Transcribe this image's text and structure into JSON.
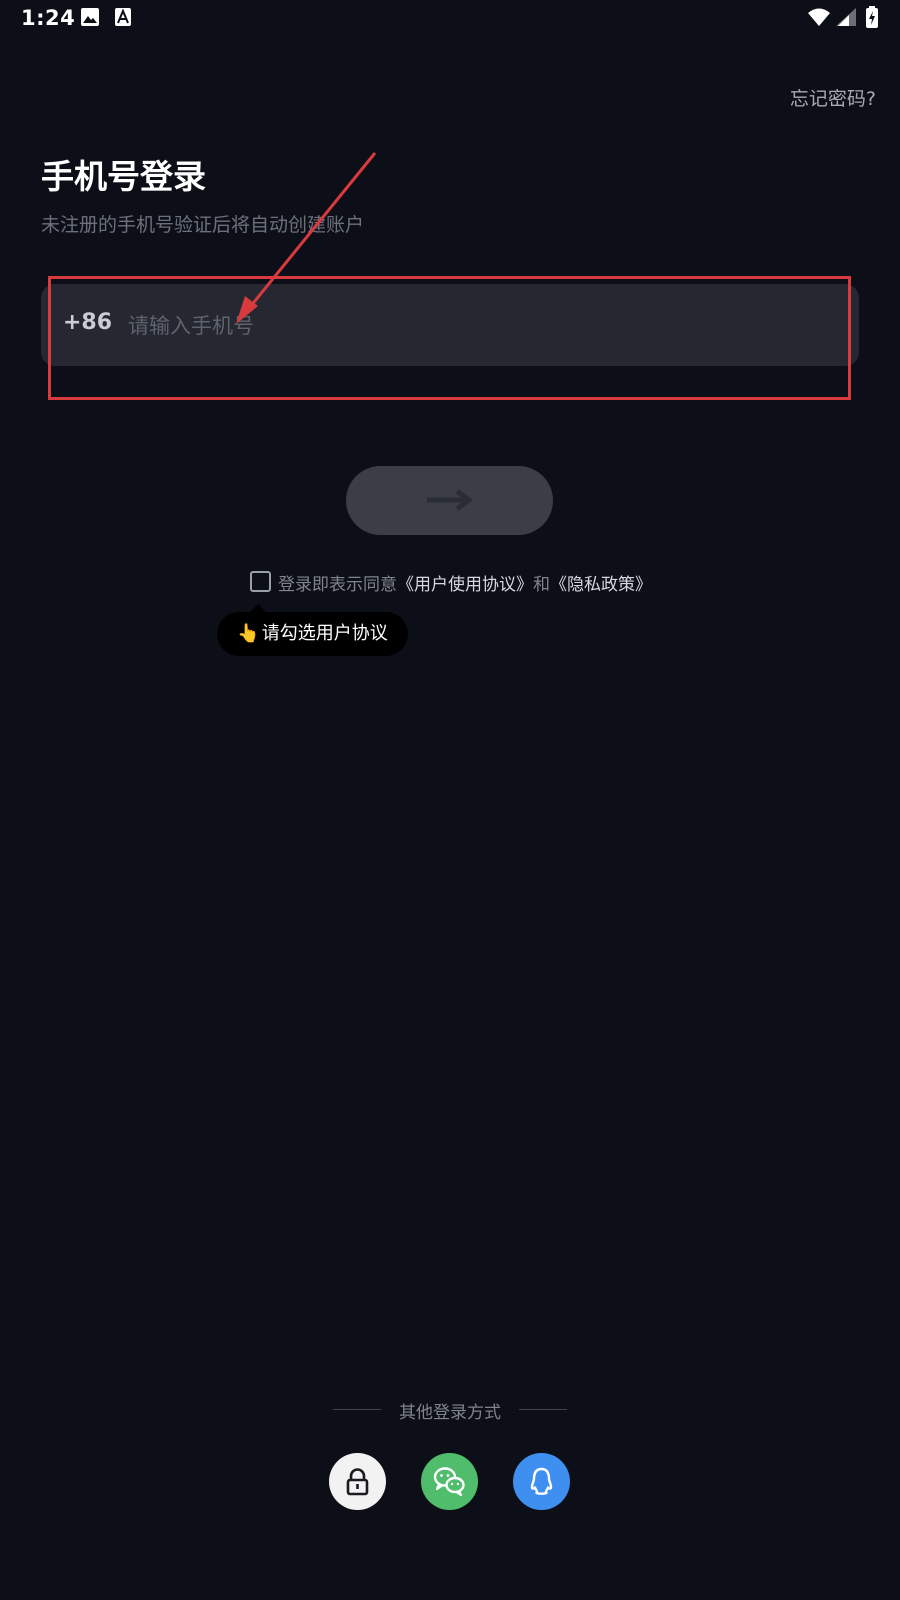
{
  "status_bar": {
    "time": "1:24",
    "icons": [
      "image-icon",
      "text-a-icon",
      "wifi-icon",
      "signal-icon",
      "battery-charging-icon"
    ]
  },
  "header": {
    "forgot_password": "忘记密码?"
  },
  "login": {
    "title": "手机号登录",
    "subtitle": "未注册的手机号验证后将自动创建账户",
    "country_code": "+86",
    "phone_placeholder": "请输入手机号",
    "phone_value": ""
  },
  "agreement": {
    "checked": false,
    "prefix": "登录即表示同意",
    "user_agreement": "《用户使用协议》",
    "and": "和",
    "privacy_policy": "《隐私政策》"
  },
  "tooltip": {
    "hand": "👆",
    "text": "请勾选用户协议"
  },
  "other_login": {
    "label": "其他登录方式",
    "options": [
      "lock-icon",
      "wechat-icon",
      "qq-icon"
    ]
  },
  "colors": {
    "background": "#0d0f18",
    "field_background": "#252831",
    "button_disabled": "#3b3e47",
    "annotation_red": "#d93a3e",
    "wechat_green": "#4fbd6b",
    "qq_blue": "#3f8ff0"
  }
}
